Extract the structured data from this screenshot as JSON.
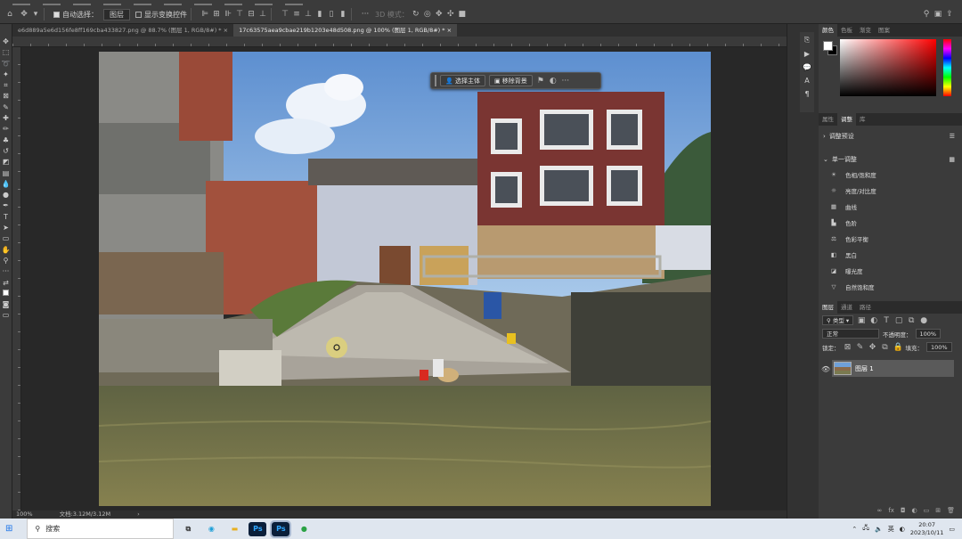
{
  "options": {
    "auto_select_label": "自动选择：",
    "auto_select_value": "图层",
    "show_transform_label": "显示变换控件",
    "mode_3d_label": "3D 模式："
  },
  "tabs": [
    {
      "label": "e6d889a5e6d156fe8ff169cba433827.png @ 88.7% (图层 1, RGB/8#) *",
      "close": "×"
    },
    {
      "label": "17c63575aea9cbae219b1203e48d508.png @ 100% (图层 1, RGB/8#) *",
      "close": "×"
    }
  ],
  "context_bar": {
    "select_subject": "选择主体",
    "remove_background": "移除背景",
    "more": "···"
  },
  "status": {
    "zoom": "100%",
    "doc": "文档:3.12M/3.12M",
    "arrow": "›"
  },
  "color_panel": {
    "tabs": [
      "颜色",
      "色板",
      "渐变",
      "图案"
    ]
  },
  "adjust_panel": {
    "tabs": [
      "属性",
      "调整",
      "库"
    ],
    "presets_label": "调整预设",
    "single_label": "单一调整",
    "items": [
      {
        "icon": "☀",
        "label": "色相/饱和度"
      },
      {
        "icon": "☼",
        "label": "亮度/对比度"
      },
      {
        "icon": "▦",
        "label": "曲线"
      },
      {
        "icon": "▙",
        "label": "色阶"
      },
      {
        "icon": "⚖",
        "label": "色彩平衡"
      },
      {
        "icon": "◧",
        "label": "黑白"
      },
      {
        "icon": "◪",
        "label": "曝光度"
      },
      {
        "icon": "▽",
        "label": "自然饱和度"
      }
    ]
  },
  "layers_panel": {
    "tabs": [
      "图层",
      "通道",
      "路径"
    ],
    "kind": "类型",
    "blend": "正常",
    "opacity_label": "不透明度：",
    "opacity": "100%",
    "lock_label": "锁定：",
    "fill_label": "填充：",
    "fill": "100%",
    "layer_name": "图层 1"
  },
  "taskbar": {
    "search": "搜索",
    "ime": "英",
    "time": "20:07",
    "date": "2023/10/11"
  }
}
